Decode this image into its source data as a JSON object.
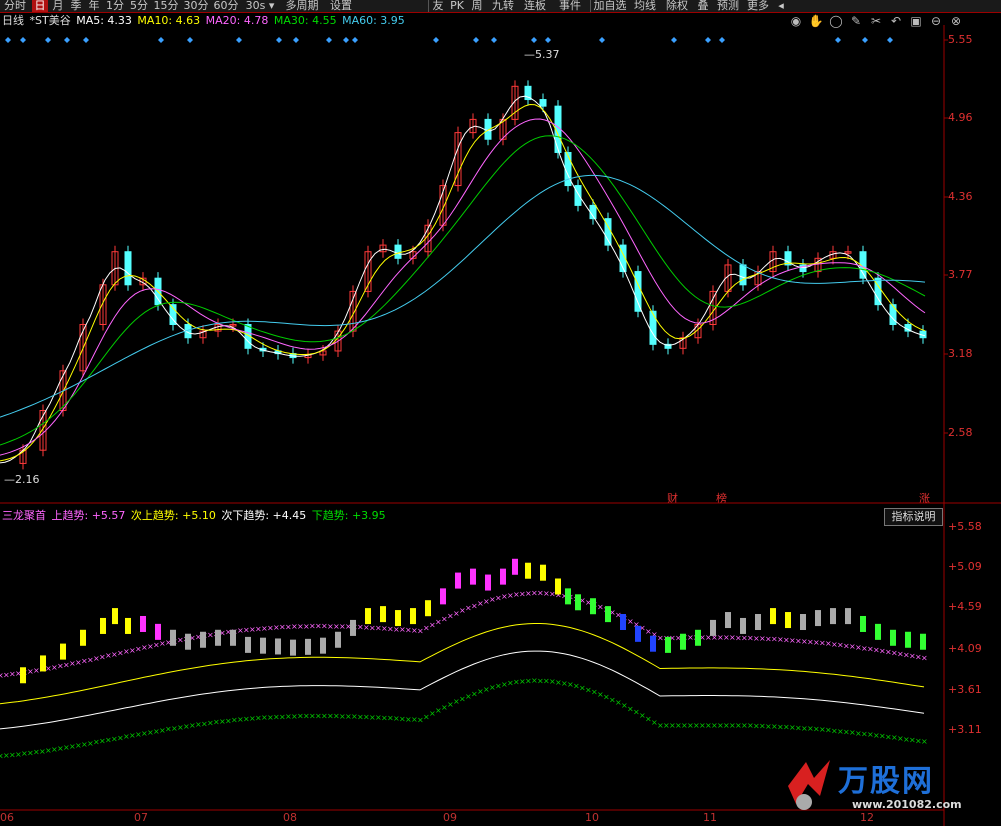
{
  "toolbar": {
    "items": [
      "分时",
      "日",
      "月",
      "季",
      "年",
      "1分",
      "5分",
      "15分",
      "30分",
      "60分",
      "30s ▾",
      "多周期",
      "设置",
      "友",
      "PK",
      "周",
      "九转",
      "连板",
      "事件",
      "加自选",
      "均线",
      "除权",
      "叠",
      "预测",
      "更多",
      "◂"
    ],
    "active_index": 1
  },
  "legend_top": {
    "period": "日线",
    "stock": "*ST美谷",
    "ma5": "MA5: 4.33",
    "ma10": "MA10: 4.63",
    "ma20": "MA20: 4.78",
    "ma30": "MA30: 4.55",
    "ma60": "MA60: 3.95"
  },
  "legend_bottom": {
    "name": "三龙聚首",
    "up": "上趋势: +5.57",
    "up2": "次上趋势: +5.10",
    "down2": "次下趋势: +4.45",
    "down": "下趋势: +3.95"
  },
  "indicator_button": "指标说明",
  "tags": {
    "cai": "财",
    "bang": "榜",
    "zhang": "涨"
  },
  "icon_names": [
    "eye-icon",
    "hand-icon",
    "circle-icon",
    "pen-icon",
    "scissors-icon",
    "undo-icon",
    "box-icon",
    "minus-icon",
    "close-icon"
  ],
  "watermark": {
    "text": "万股网",
    "url": "www.201082.com"
  },
  "colors": {
    "up": "#ff3a3a",
    "down": "#54ffff",
    "ma5": "#ffffff",
    "ma10": "#ffff00",
    "ma20": "#ff66ff",
    "ma30": "#00cc00",
    "ma60": "#44ccee"
  },
  "chart_data": [
    {
      "type": "candlestick",
      "price_axis": [
        "5.55",
        "4.96",
        "4.36",
        "3.77",
        "3.18",
        "2.58"
      ],
      "ylim": [
        2.16,
        5.57
      ],
      "high_label": "5.37",
      "low_label": "2.16",
      "x_labels": [
        "06",
        "07",
        "08",
        "09",
        "10",
        "11",
        "12"
      ],
      "series": [
        {
          "name": "MA5",
          "color": "#ffffff"
        },
        {
          "name": "MA10",
          "color": "#ffff00"
        },
        {
          "name": "MA20",
          "color": "#ff66ff"
        },
        {
          "name": "MA30",
          "color": "#00cc00"
        },
        {
          "name": "MA60",
          "color": "#44ccee"
        }
      ]
    },
    {
      "type": "line",
      "indicator_axis": [
        "+5.58",
        "+5.09",
        "+4.59",
        "+4.09",
        "+3.61",
        "+3.11"
      ],
      "series": [
        {
          "name": "上趋势",
          "color": "#ff66ff"
        },
        {
          "name": "次上趋势",
          "color": "#ffff00"
        },
        {
          "name": "次下趋势",
          "color": "#ffffff"
        },
        {
          "name": "下趋势",
          "color": "#00cc00"
        }
      ]
    }
  ]
}
